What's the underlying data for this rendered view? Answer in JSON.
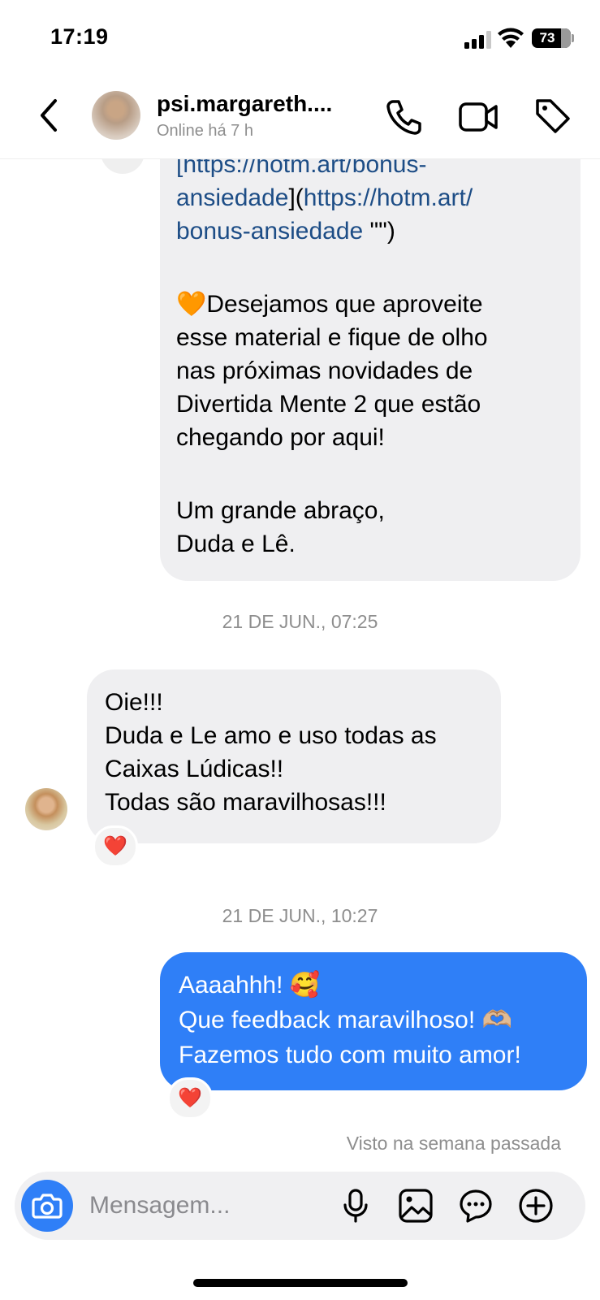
{
  "status_bar": {
    "time": "17:19",
    "battery": "73"
  },
  "header": {
    "contact_name": "psi.margareth....",
    "contact_status": "Online há 7 h"
  },
  "messages": {
    "m1": {
      "link_line_1": "[https://hotm.art/bonus-",
      "link_line_2_a": "ansiedade",
      "link_line_2_b": "](",
      "link_line_2_c": "https://hotm.art/",
      "link_line_3_a": "bonus-ansiedade",
      "link_line_3_b": " \"\")",
      "heart_emoji": "🧡",
      "paragraph_1": "Desejamos que aproveite\nesse material e fique de olho\nnas próximas novidades de\nDivertida Mente 2 que estão\nchegando por aqui!",
      "paragraph_2": "Um grande abraço,\nDuda e Lê."
    },
    "ts1": "21 DE JUN., 07:25",
    "m2": {
      "text": "Oie!!!\nDuda e Le amo e uso todas as\nCaixas Lúdicas!!\nTodas são maravilhosas!!!",
      "reaction": "❤️"
    },
    "ts2": "21 DE JUN., 10:27",
    "m3": {
      "line_1": "Aaaahhh! 🥰",
      "line_2": "Que feedback maravilhoso! 🫶🏼",
      "line_3": "Fazemos tudo com muito amor!",
      "reaction": "❤️"
    },
    "seen": "Visto na semana passada"
  },
  "composer": {
    "placeholder": "Mensagem..."
  },
  "colors": {
    "accent": "#2f7ff7",
    "bubble_gray": "#efeff1",
    "link": "#1d4d86",
    "meta": "#8e8e8e"
  },
  "icons": [
    "back-icon",
    "phone-icon",
    "video-icon",
    "tag-icon",
    "camera-icon",
    "microphone-icon",
    "gallery-icon",
    "sticker-icon",
    "plus-icon"
  ]
}
